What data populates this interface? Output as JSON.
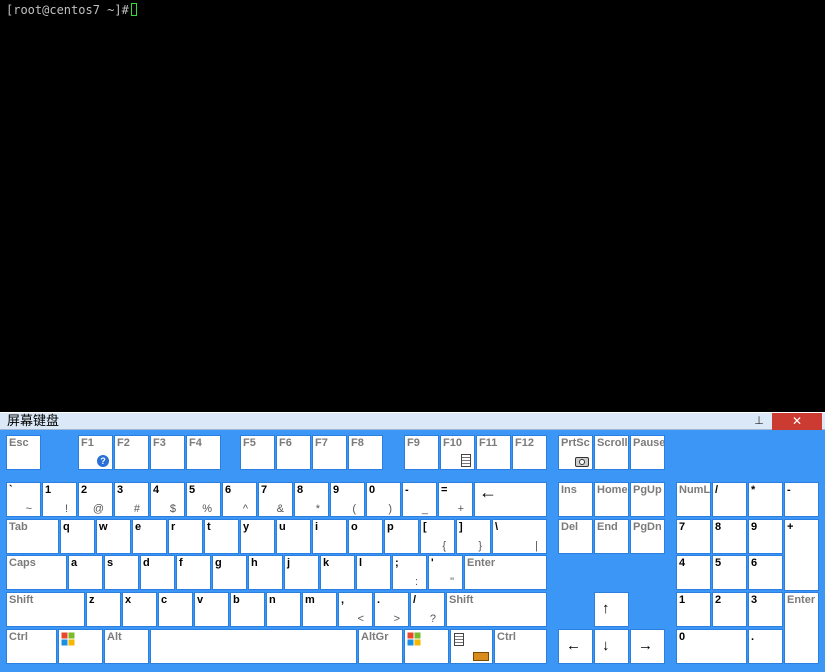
{
  "terminal": {
    "prompt": "[root@centos7 ~]# "
  },
  "osk": {
    "title": "屏幕键盘",
    "pin_glyph": "⊥",
    "close_glyph": "✕",
    "colors": {
      "background": "#3c96f5",
      "key": "#ffffff",
      "function_key_text": "#7b7b7b",
      "close_button": "#cc3b32"
    },
    "keys": [
      {
        "name": "esc",
        "label": "Esc",
        "fn": true
      },
      {
        "name": "f1",
        "label": "F1",
        "fn": true,
        "icon": "help-icon"
      },
      {
        "name": "f2",
        "label": "F2",
        "fn": true
      },
      {
        "name": "f3",
        "label": "F3",
        "fn": true
      },
      {
        "name": "f4",
        "label": "F4",
        "fn": true
      },
      {
        "name": "f5",
        "label": "F5",
        "fn": true
      },
      {
        "name": "f6",
        "label": "F6",
        "fn": true
      },
      {
        "name": "f7",
        "label": "F7",
        "fn": true
      },
      {
        "name": "f8",
        "label": "F8",
        "fn": true
      },
      {
        "name": "f9",
        "label": "F9",
        "fn": true
      },
      {
        "name": "f10",
        "label": "F10",
        "fn": true,
        "icon": "document-icon"
      },
      {
        "name": "f11",
        "label": "F11",
        "fn": true
      },
      {
        "name": "f12",
        "label": "F12",
        "fn": true
      },
      {
        "name": "prtsc",
        "label": "PrtSc",
        "fn": true,
        "icon": "camera-icon"
      },
      {
        "name": "scroll",
        "label": "Scroll",
        "fn": true
      },
      {
        "name": "pause",
        "label": "Pause",
        "fn": true
      },
      {
        "name": "backtick",
        "label": "`",
        "shift": "~"
      },
      {
        "name": "digit-1",
        "label": "1",
        "shift": "!"
      },
      {
        "name": "digit-2",
        "label": "2",
        "shift": "@"
      },
      {
        "name": "digit-3",
        "label": "3",
        "shift": "#"
      },
      {
        "name": "digit-4",
        "label": "4",
        "shift": "$"
      },
      {
        "name": "digit-5",
        "label": "5",
        "shift": "%"
      },
      {
        "name": "digit-6",
        "label": "6",
        "shift": "^"
      },
      {
        "name": "digit-7",
        "label": "7",
        "shift": "&"
      },
      {
        "name": "digit-8",
        "label": "8",
        "shift": "*"
      },
      {
        "name": "digit-9",
        "label": "9",
        "shift": "("
      },
      {
        "name": "digit-0",
        "label": "0",
        "shift": ")"
      },
      {
        "name": "minus",
        "label": "-",
        "shift": "_"
      },
      {
        "name": "equals",
        "label": "=",
        "shift": "+"
      },
      {
        "name": "backspace",
        "label": "←"
      },
      {
        "name": "ins",
        "label": "Ins",
        "fn": true
      },
      {
        "name": "home",
        "label": "Home",
        "fn": true
      },
      {
        "name": "pgup",
        "label": "PgUp",
        "fn": true
      },
      {
        "name": "numlock",
        "label": "NumL",
        "fn": true
      },
      {
        "name": "num-divide",
        "label": "/"
      },
      {
        "name": "num-multiply",
        "label": "*"
      },
      {
        "name": "num-subtract",
        "label": "-"
      },
      {
        "name": "tab",
        "label": "Tab",
        "fn": true
      },
      {
        "name": "q",
        "label": "q"
      },
      {
        "name": "w",
        "label": "w"
      },
      {
        "name": "e",
        "label": "e"
      },
      {
        "name": "r",
        "label": "r"
      },
      {
        "name": "t",
        "label": "t"
      },
      {
        "name": "y",
        "label": "y"
      },
      {
        "name": "u",
        "label": "u"
      },
      {
        "name": "i",
        "label": "i"
      },
      {
        "name": "o",
        "label": "o"
      },
      {
        "name": "p",
        "label": "p"
      },
      {
        "name": "bracket-left",
        "label": "[",
        "shift": "{"
      },
      {
        "name": "bracket-right",
        "label": "]",
        "shift": "}"
      },
      {
        "name": "backslash",
        "label": "\\",
        "shift": "|"
      },
      {
        "name": "del",
        "label": "Del",
        "fn": true
      },
      {
        "name": "end",
        "label": "End",
        "fn": true
      },
      {
        "name": "pgdn",
        "label": "PgDn",
        "fn": true
      },
      {
        "name": "num-7",
        "label": "7"
      },
      {
        "name": "num-8",
        "label": "8"
      },
      {
        "name": "num-9",
        "label": "9"
      },
      {
        "name": "num-add",
        "label": "+"
      },
      {
        "name": "caps",
        "label": "Caps",
        "fn": true
      },
      {
        "name": "a",
        "label": "a"
      },
      {
        "name": "s",
        "label": "s"
      },
      {
        "name": "d",
        "label": "d"
      },
      {
        "name": "f",
        "label": "f"
      },
      {
        "name": "g",
        "label": "g"
      },
      {
        "name": "h",
        "label": "h"
      },
      {
        "name": "j",
        "label": "j"
      },
      {
        "name": "k",
        "label": "k"
      },
      {
        "name": "l",
        "label": "l"
      },
      {
        "name": "semicolon",
        "label": ";",
        "shift": ":"
      },
      {
        "name": "quote",
        "label": "'",
        "shift": "\""
      },
      {
        "name": "enter",
        "label": "Enter",
        "fn": true
      },
      {
        "name": "num-4",
        "label": "4"
      },
      {
        "name": "num-5",
        "label": "5"
      },
      {
        "name": "num-6",
        "label": "6"
      },
      {
        "name": "shift-left",
        "label": "Shift",
        "fn": true
      },
      {
        "name": "z",
        "label": "z"
      },
      {
        "name": "x",
        "label": "x"
      },
      {
        "name": "c",
        "label": "c"
      },
      {
        "name": "v",
        "label": "v"
      },
      {
        "name": "b",
        "label": "b"
      },
      {
        "name": "n",
        "label": "n"
      },
      {
        "name": "m",
        "label": "m"
      },
      {
        "name": "comma",
        "label": ",",
        "shift": "<"
      },
      {
        "name": "period",
        "label": ".",
        "shift": ">"
      },
      {
        "name": "slash",
        "label": "/",
        "shift": "?"
      },
      {
        "name": "shift-right",
        "label": "Shift",
        "fn": true
      },
      {
        "name": "arrow-up",
        "label": "↑"
      },
      {
        "name": "num-1",
        "label": "1"
      },
      {
        "name": "num-2",
        "label": "2"
      },
      {
        "name": "num-3",
        "label": "3"
      },
      {
        "name": "num-enter",
        "label": "Enter",
        "fn": true
      },
      {
        "name": "ctrl-left",
        "label": "Ctrl",
        "fn": true
      },
      {
        "name": "win-left",
        "label": "",
        "icon": "windows-logo-icon"
      },
      {
        "name": "alt",
        "label": "Alt",
        "fn": true
      },
      {
        "name": "space",
        "label": ""
      },
      {
        "name": "altgr",
        "label": "AltGr",
        "fn": true
      },
      {
        "name": "win-right",
        "label": "",
        "icon": "windows-logo-icon"
      },
      {
        "name": "menu",
        "label": "",
        "icon": "context-menu-icon"
      },
      {
        "name": "fn-keyboard",
        "label": "",
        "icon": "keyboard-icon"
      },
      {
        "name": "ctrl-right",
        "label": "Ctrl",
        "fn": true
      },
      {
        "name": "arrow-left",
        "label": "←"
      },
      {
        "name": "arrow-down",
        "label": "↓"
      },
      {
        "name": "arrow-right",
        "label": "→"
      },
      {
        "name": "num-0",
        "label": "0"
      },
      {
        "name": "num-decimal",
        "label": "."
      }
    ]
  }
}
